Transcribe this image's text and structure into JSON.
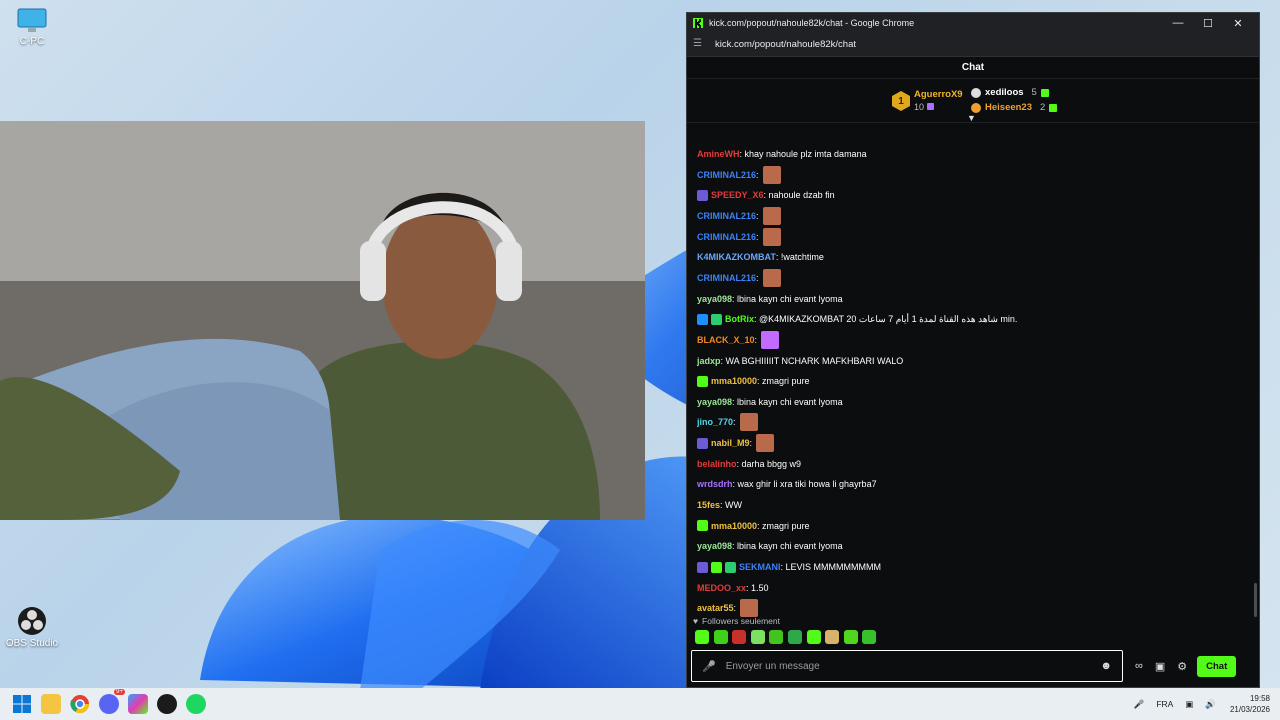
{
  "desktop": {
    "icons": [
      {
        "label": "C-PC"
      },
      {
        "label": "OBS Studio"
      }
    ]
  },
  "browser": {
    "title": "kick.com/popout/nahoule82k/chat - Google Chrome",
    "url": "kick.com/popout/nahoule82k/chat"
  },
  "chat": {
    "header": "Chat",
    "leaderboard": {
      "first": {
        "rank": "1",
        "name": "AguerroX9",
        "count": "10",
        "color": "#f0b429"
      },
      "second": {
        "name": "xediloos",
        "count": "5",
        "color": "#ffffff"
      },
      "third": {
        "name": "Heiseen23",
        "count": "2",
        "color": "#f0a030"
      }
    },
    "messages": [
      {
        "user": "AmineWH",
        "color": "#e53b3b",
        "text": ": khay nahoule plz imta damana",
        "badges": [],
        "emote": ""
      },
      {
        "user": "CRIMINAL216",
        "color": "#3b82f6",
        "text": ":",
        "badges": [],
        "emote": "face-emote"
      },
      {
        "user": "SPEEDY_X6",
        "color": "#e53b3b",
        "text": ": nahoule dzab fin",
        "badges": [
          "rocket-badge"
        ],
        "emote": ""
      },
      {
        "user": "CRIMINAL216",
        "color": "#3b82f6",
        "text": ":",
        "badges": [],
        "emote": "face-emote"
      },
      {
        "user": "CRIMINAL216",
        "color": "#3b82f6",
        "text": ":",
        "badges": [],
        "emote": "face-emote"
      },
      {
        "user": "K4MIKAZKOMBAT",
        "color": "#6aa6ff",
        "text": ": !watchtime",
        "badges": [],
        "emote": ""
      },
      {
        "user": "CRIMINAL216",
        "color": "#3b82f6",
        "text": ":",
        "badges": [],
        "emote": "face-emote"
      },
      {
        "user": "yaya098",
        "color": "#9ee89a",
        "text": ": lbina kayn chi evant lyoma",
        "badges": [],
        "emote": ""
      },
      {
        "user": "BotRix",
        "color": "#53fc18",
        "text": ": @K4MIKAZKOMBAT 20 شاهد هذه القناة لمدة 1 أيام 7 ساعات min.",
        "badges": [
          "bot-badge",
          "verified-badge"
        ],
        "emote": ""
      },
      {
        "user": "BLACK_X_10",
        "color": "#f08a24",
        "text": ":",
        "badges": [],
        "emote": "feather-emote"
      },
      {
        "user": "jadxp",
        "color": "#9ee89a",
        "text": ": WA BGHIIIIIT NCHARK MAFKHBARI WALO",
        "badges": [],
        "emote": ""
      },
      {
        "user": "mma10000",
        "color": "#f0c040",
        "text": ": zmagri pure",
        "badges": [
          "gift-badge"
        ],
        "emote": ""
      },
      {
        "user": "yaya098",
        "color": "#9ee89a",
        "text": ": lbina kayn chi evant lyoma",
        "badges": [],
        "emote": ""
      },
      {
        "user": "jino_770",
        "color": "#53d6e8",
        "text": ":",
        "badges": [],
        "emote": "face-emote"
      },
      {
        "user": "nabil_M9",
        "color": "#f0c040",
        "text": ":",
        "badges": [
          "rocket-badge"
        ],
        "emote": "face-emote"
      },
      {
        "user": "belalinho",
        "color": "#e53b3b",
        "text": ": darha bbgg w9",
        "badges": [],
        "emote": ""
      },
      {
        "user": "wrdsdrh",
        "color": "#a970ff",
        "text": ": wax ghir li xra tiki howa li ghayrba7",
        "badges": [],
        "emote": ""
      },
      {
        "user": "15fes",
        "color": "#f0c040",
        "text": ": WW",
        "badges": [],
        "emote": ""
      },
      {
        "user": "mma10000",
        "color": "#f0c040",
        "text": ": zmagri pure",
        "badges": [
          "gift-badge"
        ],
        "emote": ""
      },
      {
        "user": "yaya098",
        "color": "#9ee89a",
        "text": ": lbina kayn chi evant lyoma",
        "badges": [],
        "emote": ""
      },
      {
        "user": "SEKMANI",
        "color": "#3b82f6",
        "text": ": LEVIS MMMMMMMMM",
        "badges": [
          "rocket-badge",
          "gift-badge",
          "verified-badge"
        ],
        "emote": ""
      },
      {
        "user": "MEDOO_xx",
        "color": "#e53b3b",
        "text": ": 1.50",
        "badges": [],
        "emote": ""
      },
      {
        "user": "avatar55",
        "color": "#f0c040",
        "text": ":",
        "badges": [],
        "emote": "face-emote"
      }
    ],
    "followers_only": "Followers seulement",
    "input_placeholder": "Envoyer un message",
    "send_label": "Chat"
  },
  "taskbar": {
    "language": "FRA",
    "time": "19:58",
    "date": "21/03/2026",
    "discord_badge": "9+"
  }
}
